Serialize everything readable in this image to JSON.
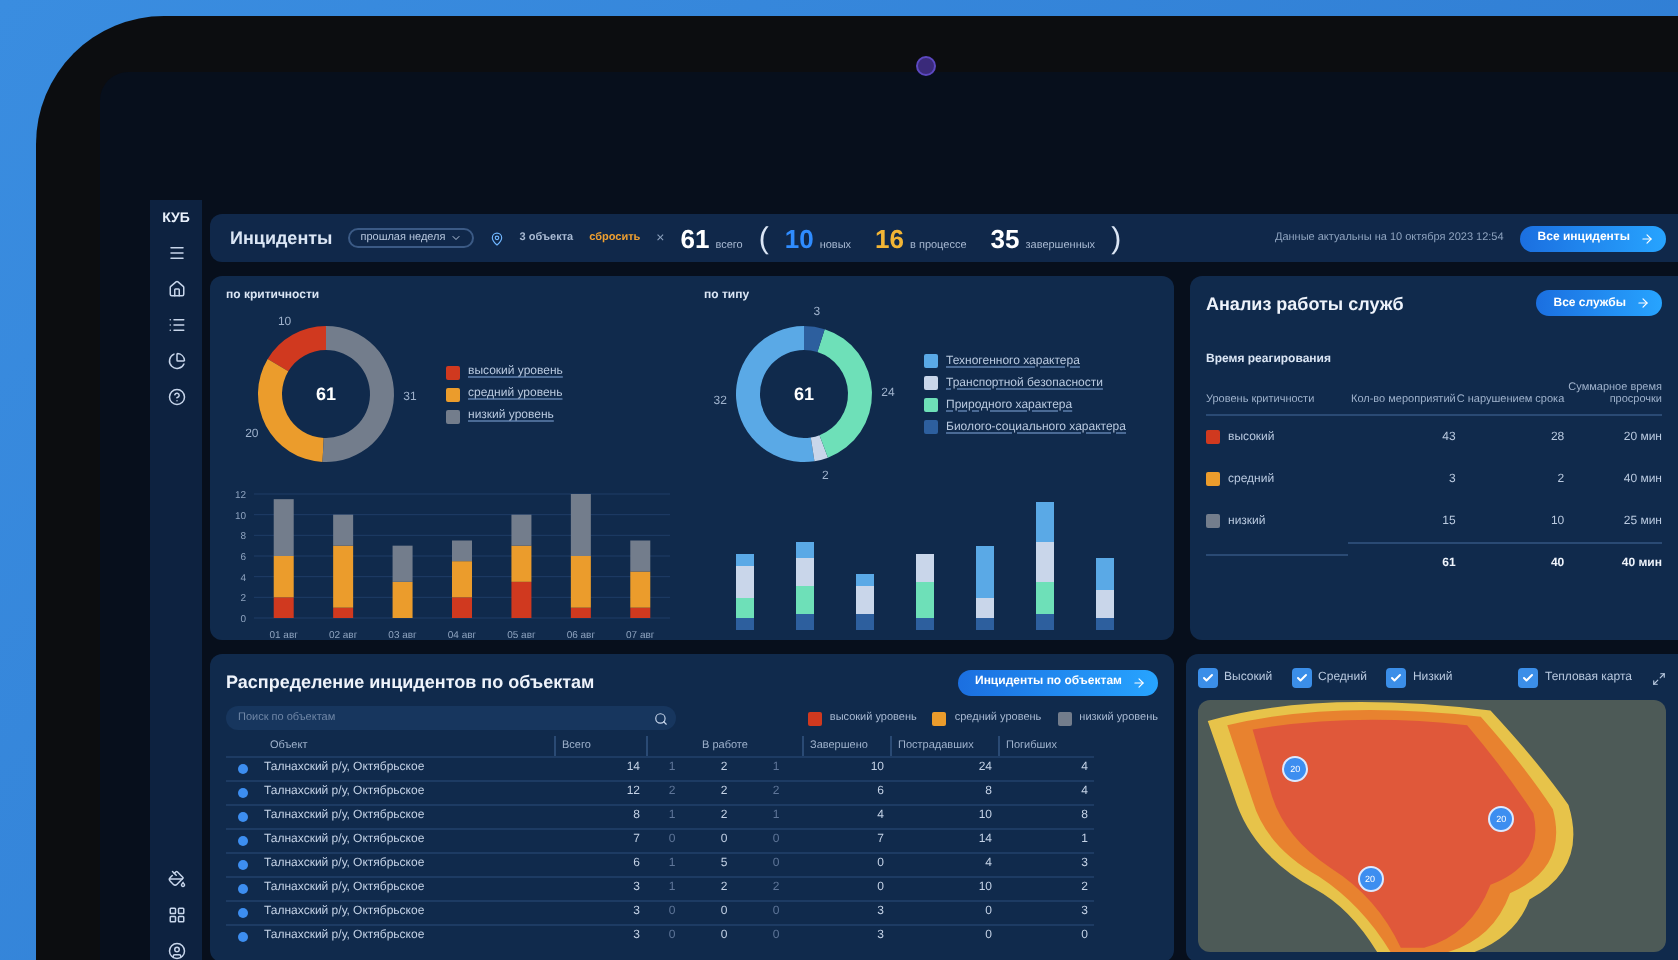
{
  "sidebar": {
    "logo": "КУБ"
  },
  "header": {
    "title": "Инциденты",
    "period": "прошлая неделя",
    "filter": {
      "objects": "3 объекта",
      "reset": "сбросить",
      "clear": "×"
    },
    "total": {
      "value": "61",
      "label": "всего"
    },
    "open_paren": "(",
    "counts": [
      {
        "value": "10",
        "label": "новых",
        "color": "#2f8cff"
      },
      {
        "value": "16",
        "label": "в процессе",
        "color": "#f2b535"
      },
      {
        "value": "35",
        "label": "завершенных",
        "color": "#ffffff"
      }
    ],
    "close_paren": ")",
    "updated": "Данные актуальны на 10 октября 2023 12:54",
    "button": "Все инциденты"
  },
  "criticality": {
    "title": "по критичности",
    "donut": {
      "center": "61",
      "chart_data": {
        "type": "donut",
        "values": [
          10,
          20,
          31
        ],
        "data_labels": true
      }
    },
    "bars": {
      "chart_data": {
        "type": "bar",
        "stacked": true,
        "categories": [
          "01 авг",
          "02 авг",
          "03 авг",
          "04 авг",
          "05 авг",
          "06 авг",
          "07 авг"
        ],
        "ylim": [
          0,
          12
        ],
        "grid": true,
        "yticks": [
          0,
          2,
          4,
          6,
          8,
          10,
          12
        ],
        "series": [
          {
            "name": "высокий уровень",
            "color": "#d0391f",
            "values": [
              2,
              1,
              0,
              2,
              3.5,
              1,
              1
            ]
          },
          {
            "name": "средний уровень",
            "color": "#eb9c2c",
            "values": [
              4,
              6,
              3.5,
              3.5,
              3.5,
              5,
              3.5
            ]
          },
          {
            "name": "низкий уровень",
            "color": "#737d8c",
            "values": [
              5.5,
              3,
              3.5,
              2,
              3,
              6,
              3
            ]
          }
        ]
      }
    }
  },
  "type": {
    "title": "по типу",
    "legend": [
      {
        "label": "Техногенного характера",
        "color": "#5aa9e6"
      },
      {
        "label": "Транспортной безопасности",
        "color": "#c9d6ea"
      },
      {
        "label": "Природного характера",
        "color": "#6ee0b8"
      },
      {
        "label": "Биолого-социального характера",
        "color": "#2d5f9e"
      }
    ],
    "donut": {
      "center": "61",
      "chart_data": {
        "type": "donut",
        "values": [
          32,
          2,
          24,
          3
        ],
        "data_labels": true
      }
    }
  },
  "services": {
    "title": "Анализ работы служб",
    "button": "Все службы",
    "subtitle": "Время реагирования",
    "columns": [
      "Уровень критичности",
      "Кол-во мероприятий",
      "С нарушением срока",
      "Суммарное время просрочки"
    ],
    "rows": [
      {
        "level": "высокий",
        "color": "#d0391f",
        "count": "43",
        "overdue": "28",
        "delay": "20 мин"
      },
      {
        "level": "средний",
        "color": "#eb9c2c",
        "count": "3",
        "overdue": "2",
        "delay": "40 мин"
      },
      {
        "level": "низкий",
        "color": "#737d8c",
        "count": "15",
        "overdue": "10",
        "delay": "25 мин"
      }
    ],
    "total": {
      "count": "61",
      "overdue": "40",
      "delay": "40 мин"
    }
  },
  "objects": {
    "title": "Распределение инцидентов по объектам",
    "button": "Инциденты по объектам",
    "search": {
      "placeholder": "Поиск по объектам"
    },
    "legend": [
      {
        "label": "высокий уровень",
        "color": "#d0391f"
      },
      {
        "label": "средний уровень",
        "color": "#eb9c2c"
      },
      {
        "label": "низкий уровень",
        "color": "#737d8c"
      }
    ],
    "columns": [
      "Объект",
      "Всего",
      "В работе",
      "Завершено",
      "Пострадавших",
      "Погибших"
    ],
    "rows": [
      {
        "name": "Талнахский р/у, Октябрьское",
        "total": "14",
        "in_work": [
          "1",
          "2",
          "1"
        ],
        "done": "10",
        "injured": "24",
        "dead": "4"
      },
      {
        "name": "Талнахский р/у, Октябрьское",
        "total": "12",
        "in_work": [
          "2",
          "2",
          "2"
        ],
        "done": "6",
        "injured": "8",
        "dead": "4"
      },
      {
        "name": "Талнахский р/у, Октябрьское",
        "total": "8",
        "in_work": [
          "1",
          "2",
          "1"
        ],
        "done": "4",
        "injured": "10",
        "dead": "8"
      },
      {
        "name": "Талнахский р/у, Октябрьское",
        "total": "7",
        "in_work": [
          "0",
          "0",
          "0"
        ],
        "done": "7",
        "injured": "14",
        "dead": "1"
      },
      {
        "name": "Талнахский р/у, Октябрьское",
        "total": "6",
        "in_work": [
          "1",
          "5",
          "0"
        ],
        "done": "0",
        "injured": "4",
        "dead": "3"
      },
      {
        "name": "Талнахский р/у, Октябрьское",
        "total": "3",
        "in_work": [
          "1",
          "2",
          "2"
        ],
        "done": "0",
        "injured": "10",
        "dead": "2"
      },
      {
        "name": "Талнахский р/у, Октябрьское",
        "total": "3",
        "in_work": [
          "0",
          "0",
          "0"
        ],
        "done": "3",
        "injured": "0",
        "dead": "3"
      },
      {
        "name": "Талнахский р/у, Октябрьское",
        "total": "3",
        "in_work": [
          "0",
          "0",
          "0"
        ],
        "done": "3",
        "injured": "0",
        "dead": "0"
      }
    ]
  },
  "map": {
    "filters": [
      {
        "label": "Высокий",
        "checked": true
      },
      {
        "label": "Средний",
        "checked": true
      },
      {
        "label": "Низкий",
        "checked": true
      }
    ],
    "heatmap": {
      "label": "Тепловая карта",
      "checked": true
    },
    "markers": [
      "20",
      "20",
      "20"
    ]
  }
}
